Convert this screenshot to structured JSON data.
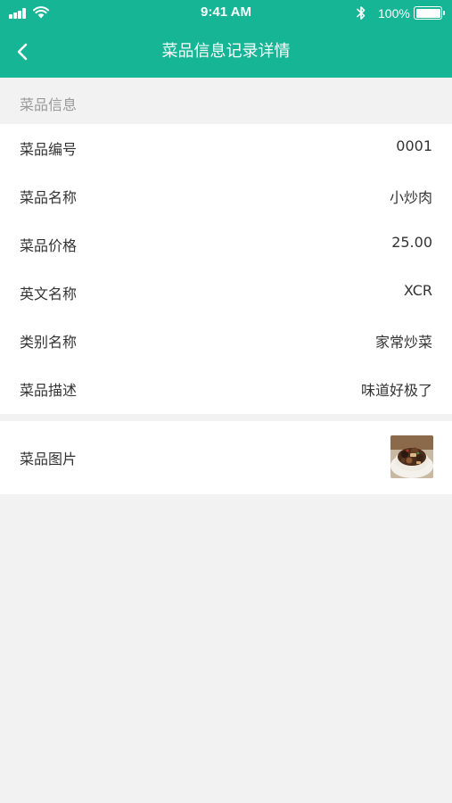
{
  "status_bar": {
    "time": "9:41 AM",
    "battery": "100%",
    "icons": [
      "signal-icon",
      "wifi-icon",
      "bluetooth-icon",
      "battery-icon"
    ]
  },
  "nav": {
    "title": "菜品信息记录详情",
    "back_icon": "chevron-left-icon"
  },
  "section": {
    "title": "菜品信息"
  },
  "fields": [
    {
      "label": "菜品编号",
      "value": "0001"
    },
    {
      "label": "菜品名称",
      "value": "小炒肉"
    },
    {
      "label": "菜品价格",
      "value": "25.00"
    },
    {
      "label": "英文名称",
      "value": "XCR"
    },
    {
      "label": "类别名称",
      "value": "家常炒菜"
    },
    {
      "label": "菜品描述",
      "value": "味道好极了"
    }
  ],
  "photo": {
    "label": "菜品图片"
  },
  "colors": {
    "header": "#15b596",
    "background": "#f2f2f2",
    "card": "#ffffff",
    "text": "#333333",
    "muted": "#999999"
  }
}
